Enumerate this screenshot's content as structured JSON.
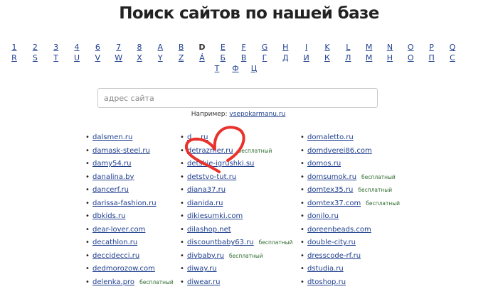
{
  "page_title": "Поиск сайтов по нашей базе",
  "letters": {
    "row1": [
      "1",
      "2",
      "3",
      "4",
      "6",
      "7",
      "8",
      "A",
      "B",
      "D",
      "E",
      "F",
      "G",
      "H",
      "I",
      "K",
      "L",
      "M",
      "N",
      "O",
      "P",
      "Q"
    ],
    "row2": [
      "R",
      "S",
      "T",
      "U",
      "V",
      "W",
      "X",
      "Y",
      "Z",
      "Á",
      "Б",
      "В",
      "Г",
      "Д",
      "И",
      "К",
      "Л",
      "М",
      "Н",
      "О",
      "П",
      "С"
    ],
    "row3": [
      "Т",
      "Ф",
      "Ц"
    ],
    "current": "D"
  },
  "search": {
    "placeholder": "адрес сайта",
    "value": ""
  },
  "example": {
    "label": "Например:",
    "link": "vsepokarmanu.ru"
  },
  "badge_free": "бесплатный",
  "sites": {
    "col1": [
      {
        "name": "dalsmen.ru",
        "free": false
      },
      {
        "name": "damask-steel.ru",
        "free": false
      },
      {
        "name": "damy54.ru",
        "free": false
      },
      {
        "name": "danalina.by",
        "free": false
      },
      {
        "name": "dancerf.ru",
        "free": false
      },
      {
        "name": "darissa-fashion.ru",
        "free": false
      },
      {
        "name": "dbkids.ru",
        "free": false
      },
      {
        "name": "dear-lover.com",
        "free": false
      },
      {
        "name": "decathlon.ru",
        "free": false
      },
      {
        "name": "deccidecci.ru",
        "free": false
      },
      {
        "name": "dedmorozow.com",
        "free": false
      },
      {
        "name": "delenka.pro",
        "free": true
      }
    ],
    "col2": [
      {
        "name": "d....ru",
        "free": false
      },
      {
        "name": "detrazmer.ru",
        "free": true
      },
      {
        "name": "detskie-igrushki.su",
        "free": false
      },
      {
        "name": "detstvo-tut.ru",
        "free": false
      },
      {
        "name": "diana37.ru",
        "free": false
      },
      {
        "name": "dianida.ru",
        "free": false
      },
      {
        "name": "dikiesumki.com",
        "free": false
      },
      {
        "name": "dilashop.net",
        "free": false
      },
      {
        "name": "discountbaby63.ru",
        "free": true
      },
      {
        "name": "divbaby.ru",
        "free": true
      },
      {
        "name": "diway.ru",
        "free": false
      },
      {
        "name": "diwear.ru",
        "free": false
      }
    ],
    "col3": [
      {
        "name": "domaletto.ru",
        "free": false
      },
      {
        "name": "domdverei86.com",
        "free": false
      },
      {
        "name": "domos.ru",
        "free": false
      },
      {
        "name": "domsumok.ru",
        "free": true
      },
      {
        "name": "domtex35.ru",
        "free": true
      },
      {
        "name": "domtex37.com",
        "free": true
      },
      {
        "name": "donilo.ru",
        "free": false
      },
      {
        "name": "doreenbeads.com",
        "free": false
      },
      {
        "name": "double-city.ru",
        "free": false
      },
      {
        "name": "dresscode-rf.ru",
        "free": false
      },
      {
        "name": "dstudia.ru",
        "free": false
      },
      {
        "name": "dtoshop.ru",
        "free": false
      }
    ]
  },
  "annotation_color": "#e8322b"
}
